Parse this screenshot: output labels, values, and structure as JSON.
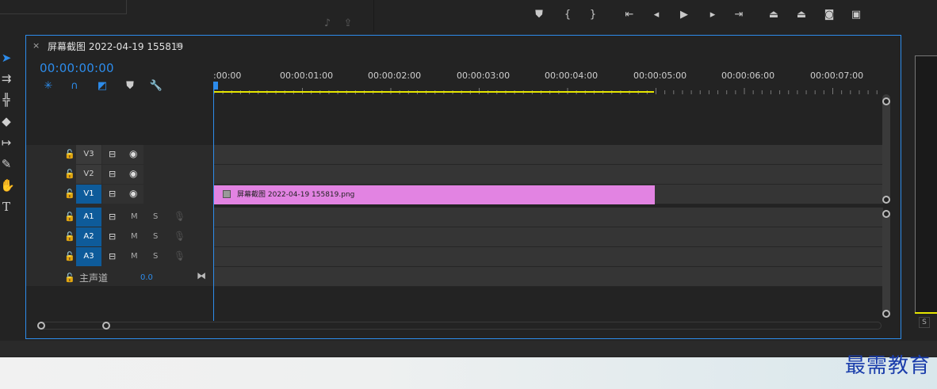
{
  "sequence": {
    "close_glyph": "×",
    "title": "屏幕截图 2022-04-19 155819",
    "menu_glyph": "≡",
    "timecode": "00:00:00:00"
  },
  "ruler": {
    "labels": [
      ":00:00",
      "00:00:01:00",
      "00:00:02:00",
      "00:00:03:00",
      "00:00:04:00",
      "00:00:05:00",
      "00:00:06:00",
      "00:00:07:00"
    ]
  },
  "tracks": {
    "video": [
      {
        "name": "V3",
        "active": false
      },
      {
        "name": "V2",
        "active": false
      },
      {
        "name": "V1",
        "active": true
      }
    ],
    "audio": [
      {
        "name": "A1",
        "m": "M",
        "s": "S"
      },
      {
        "name": "A2",
        "m": "M",
        "s": "S"
      },
      {
        "name": "A3",
        "m": "M",
        "s": "S"
      }
    ],
    "master": {
      "label": "主声道",
      "value": "0.0"
    }
  },
  "clip": {
    "label": "屏幕截图 2022-04-19  155819.png",
    "color": "#e283e2"
  },
  "right_panel": {
    "s_label": "S"
  },
  "watermark": "最需教育",
  "colors": {
    "accent": "#2d8ceb",
    "work_area": "#e6e600",
    "track_active": "#0e5b9a"
  },
  "icons": {
    "transport": [
      "add-marker-icon",
      "mark-in-icon",
      "mark-out-icon",
      "go-to-in-icon",
      "step-back-icon",
      "play-icon",
      "step-forward-icon",
      "go-to-out-icon",
      "lift-icon",
      "extract-icon",
      "export-frame-icon",
      "button-editor-icon"
    ],
    "tools": [
      "selection-tool-icon",
      "track-select-tool-icon",
      "ripple-edit-tool-icon",
      "razor-tool-icon",
      "slip-tool-icon",
      "pen-tool-icon",
      "hand-tool-icon",
      "type-tool-icon"
    ]
  }
}
